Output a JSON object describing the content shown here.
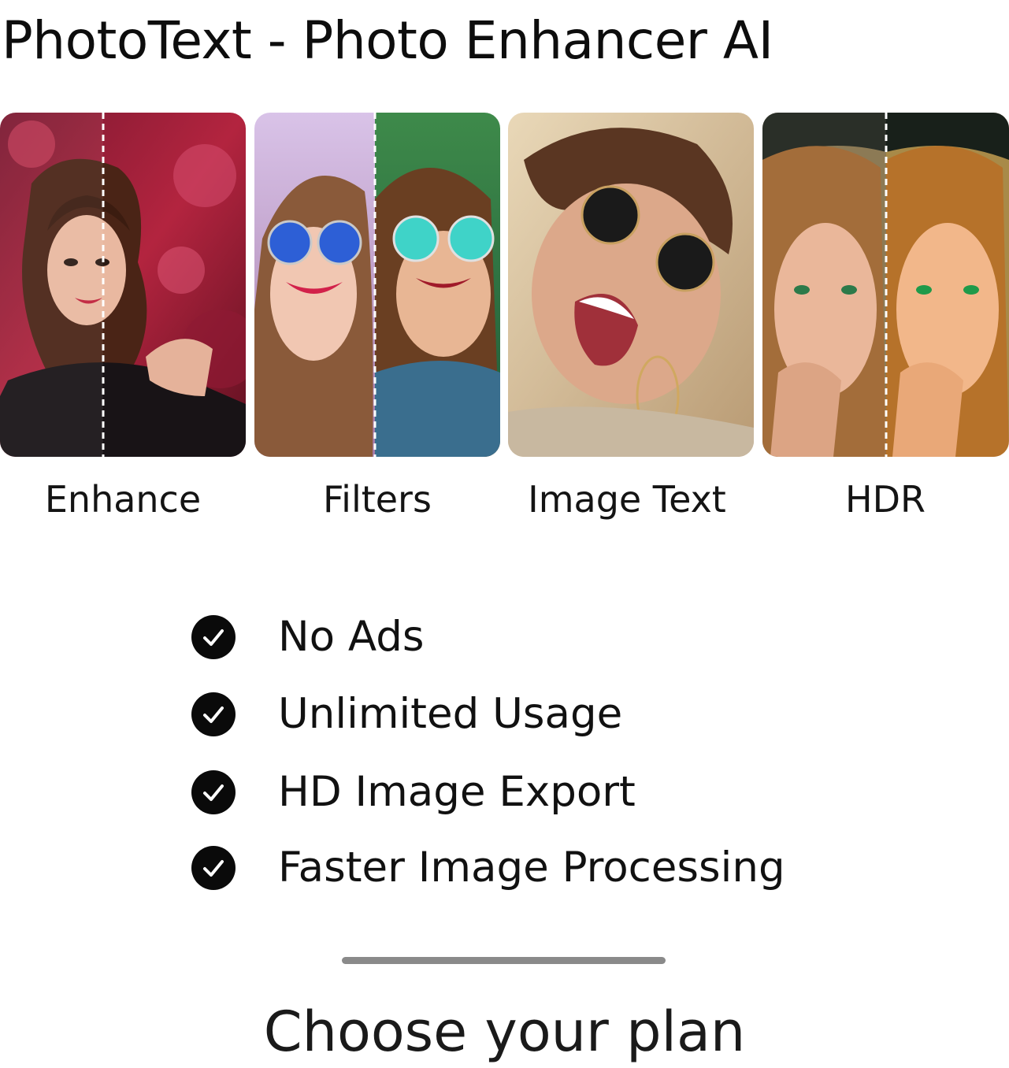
{
  "app": {
    "title": "PhotoText - Photo Enhancer AI"
  },
  "features": [
    {
      "label": "Enhance",
      "icon": "portrait-before-after"
    },
    {
      "label": "Filters",
      "icon": "portrait-sunglasses-before-after"
    },
    {
      "label": "Image Text",
      "icon": "portrait-laughing-sunglasses"
    },
    {
      "label": "HDR",
      "icon": "portrait-before-after"
    }
  ],
  "benefits": [
    {
      "label": "No Ads",
      "icon": "check-circle-icon"
    },
    {
      "label": "Unlimited Usage",
      "icon": "check-circle-icon"
    },
    {
      "label": "HD Image Export",
      "icon": "check-circle-icon"
    },
    {
      "label": "Faster Image Processing",
      "icon": "check-circle-icon"
    }
  ],
  "plans": {
    "heading": "Choose your plan"
  },
  "colors": {
    "text": "#111111",
    "check": "#0a0a0a",
    "handle": "#8a8a8a",
    "background": "#ffffff"
  }
}
